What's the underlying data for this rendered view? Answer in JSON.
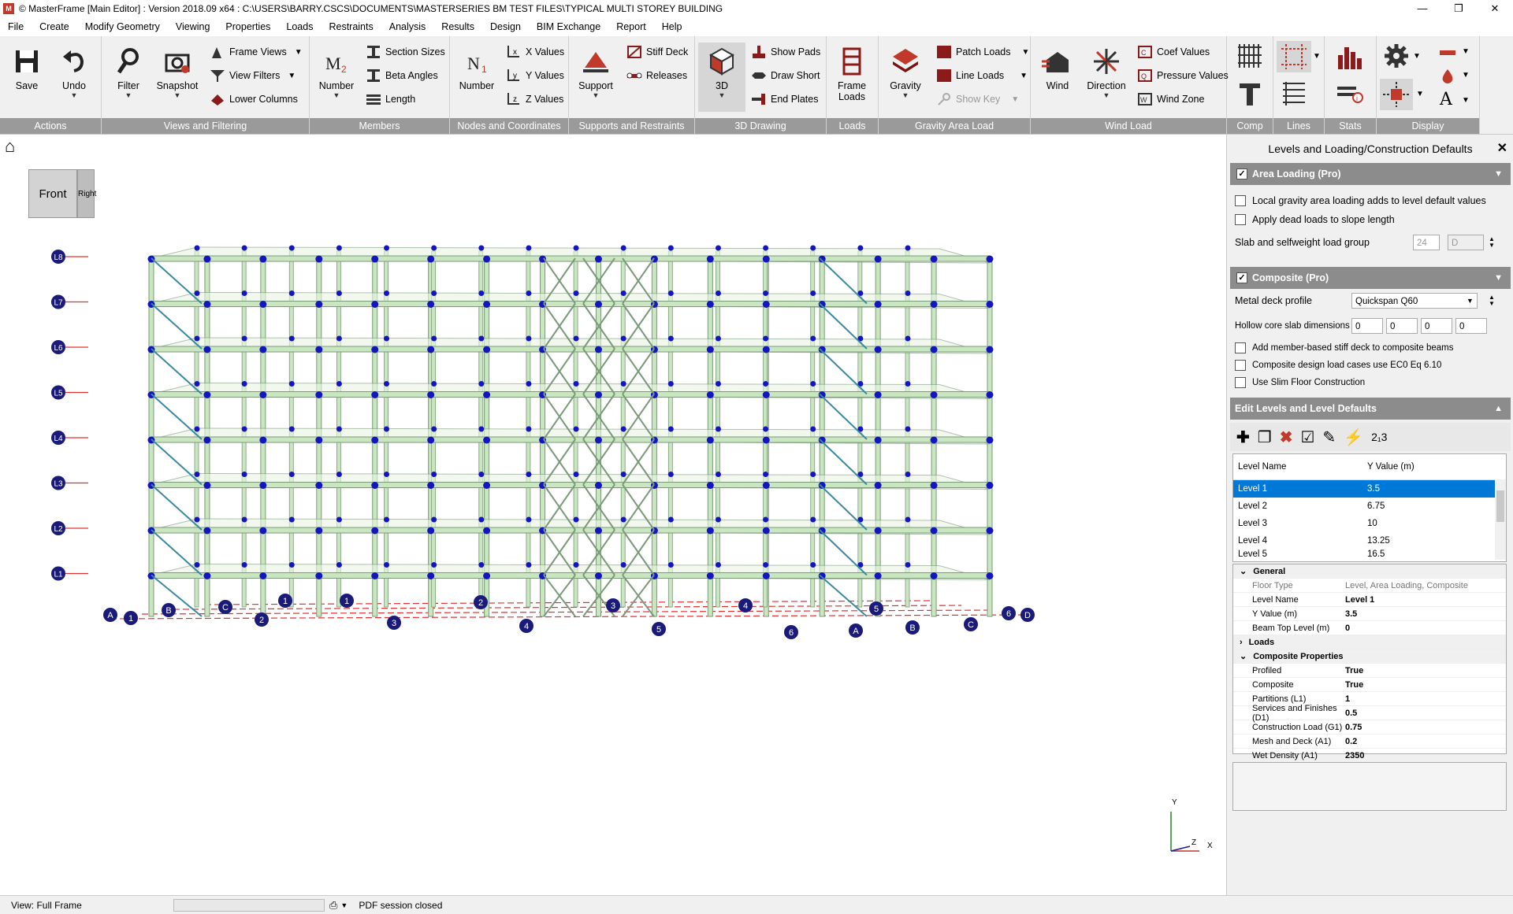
{
  "window": {
    "title": "© MasterFrame [Main Editor] : Version 2018.09 x64 : C:\\USERS\\BARRY.CSCS\\DOCUMENTS\\MASTERSERIES BM TEST FILES\\TYPICAL MULTI STOREY BUILDING",
    "minimize": "—",
    "maximize": "❐",
    "close": "✕"
  },
  "menu": [
    "File",
    "Create",
    "Modify Geometry",
    "Viewing",
    "Properties",
    "Loads",
    "Restraints",
    "Analysis",
    "Results",
    "Design",
    "BIM Exchange",
    "Report",
    "Help"
  ],
  "ribbon": {
    "groups": [
      "Actions",
      "Views and Filtering",
      "Members",
      "Nodes and Coordinates",
      "Supports and Restraints",
      "3D Drawing",
      "Loads",
      "Gravity Area Load",
      "Wind Load",
      "Comp",
      "Lines",
      "Stats",
      "Display"
    ],
    "save": "Save",
    "undo": "Undo",
    "filter": "Filter",
    "snapshot": "Snapshot",
    "frame_views": "Frame Views",
    "view_filters": "View Filters",
    "lower_columns": "Lower Columns",
    "member_number": "Number",
    "section_sizes": "Section Sizes",
    "beta_angles": "Beta Angles",
    "length": "Length",
    "node_number": "Number",
    "x_values": "X Values",
    "y_values": "Y Values",
    "z_values": "Z Values",
    "support": "Support",
    "stiff_deck": "Stiff Deck",
    "releases": "Releases",
    "btn_3d": "3D",
    "show_pads": "Show Pads",
    "draw_short": "Draw Short",
    "end_plates": "End Plates",
    "frame_loads": "Frame\nLoads",
    "gravity": "Gravity",
    "patch_loads": "Patch Loads",
    "line_loads": "Line Loads",
    "show_key": "Show Key",
    "wind": "Wind",
    "direction": "Direction",
    "coef_values": "Coef Values",
    "pressure_values": "Pressure Values",
    "wind_zone": "Wind Zone"
  },
  "viewport": {
    "nav_cube": {
      "front": "Front",
      "right": "Right"
    },
    "levels": [
      "L8",
      "L7",
      "L6",
      "L5",
      "L4",
      "L3",
      "L2",
      "L1"
    ],
    "grid_letters": [
      "A",
      "B",
      "C",
      "D"
    ],
    "grid_numbers": [
      "1",
      "2",
      "3",
      "4",
      "5",
      "6"
    ],
    "axis": {
      "y": "Y",
      "z": "Z",
      "x": "X"
    }
  },
  "panel": {
    "title": "Levels and Loading/Construction Defaults",
    "area_loading": {
      "header": "Area Loading (Pro)",
      "opt1": "Local gravity area loading adds to level default values",
      "opt2": "Apply dead loads to slope length",
      "group_label": "Slab and selfweight load group",
      "group_num": "24",
      "group_letter": "D"
    },
    "composite": {
      "header": "Composite (Pro)",
      "deck_label": "Metal deck profile",
      "deck_value": "Quickspan Q60",
      "hollow_label": "Hollow core slab dimensions",
      "hollow_values": [
        "0",
        "0",
        "0",
        "0"
      ],
      "opt1": "Add member-based stiff deck to composite beams",
      "opt2": "Composite design load cases use EC0 Eq 6.10",
      "opt3": "Use Slim Floor Construction"
    },
    "edit_levels": {
      "header": "Edit Levels and Level Defaults",
      "col1": "Level Name",
      "col2": "Y Value (m)",
      "rows": [
        {
          "name": "Level 1",
          "y": "3.5"
        },
        {
          "name": "Level 2",
          "y": "6.75"
        },
        {
          "name": "Level 3",
          "y": "10"
        },
        {
          "name": "Level 4",
          "y": "13.25"
        },
        {
          "name": "Level 5",
          "y": "16.5"
        }
      ]
    },
    "props": {
      "general": "General",
      "floor_type_k": "Floor Type",
      "floor_type_v": "Level, Area Loading, Composite",
      "level_name_k": "Level Name",
      "level_name_v": "Level 1",
      "y_value_k": "Y Value (m)",
      "y_value_v": "3.5",
      "beam_top_k": "Beam Top Level (m)",
      "beam_top_v": "0",
      "loads": "Loads",
      "composite_props": "Composite Properties",
      "profiled_k": "Profiled",
      "profiled_v": "True",
      "composite_k": "Composite",
      "composite_v": "True",
      "partitions_k": "Partitions (L1)",
      "partitions_v": "1",
      "services_k": "Services and Finishes (D1)",
      "services_v": "0.5",
      "construction_k": "Construction Load (G1)",
      "construction_v": "0.75",
      "mesh_k": "Mesh and Deck (A1)",
      "mesh_v": "0.2",
      "wet_k": "Wet Density (A1)",
      "wet_v": "2350"
    }
  },
  "status": {
    "view": "View: Full Frame",
    "pdf": "PDF session closed"
  }
}
